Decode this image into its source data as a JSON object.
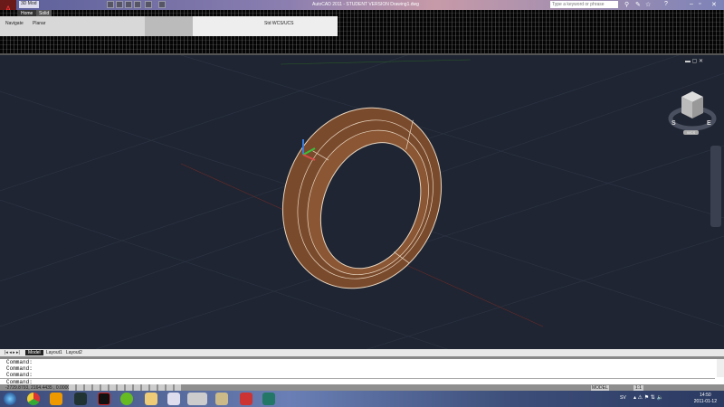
{
  "titlebar": {
    "title": "AutoCAD 2011 - STUDENT VERSION    Drawing1.dwg",
    "workspace": "3D Mod",
    "search_placeholder": "Type a keyword or phrase"
  },
  "ribbon": {
    "tabs": [
      "Home",
      "Solid"
    ],
    "panel_labels": [
      "Navigate",
      "Planar"
    ],
    "style_label": "Std WCS/UCS"
  },
  "viewcube": {
    "faces": [
      "TOP",
      "FRONT",
      "RIGHT"
    ],
    "compass": [
      "S",
      "E"
    ],
    "wcs_label": "WCS"
  },
  "layout_tabs": [
    "Model",
    "Layout1",
    "Layout2"
  ],
  "command_lines": [
    "Command:",
    "Command:",
    "Command:"
  ],
  "command_prompt": "Command:",
  "status": {
    "coords": "-2729.8793, 2164.4435 , 0.0000",
    "model": "MODEL",
    "scale": "1:1"
  },
  "taskbar": {
    "language": "SV",
    "time": "14:50",
    "date": "2011-01-12"
  },
  "colors": {
    "viewport": "#1f2532",
    "ring": "#7a4a2c"
  }
}
